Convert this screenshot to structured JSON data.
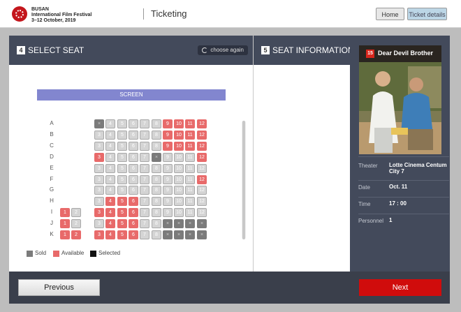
{
  "header": {
    "brand": [
      "BUSAN",
      "International Film Festival",
      "3–12 October, 2019"
    ],
    "page_title": "Ticketing",
    "home_label": "Home",
    "ticket_details_label": "Ticket details"
  },
  "select_seat": {
    "step_number": "4",
    "title": "SELECT SEAT",
    "choose_again_label": "choose again",
    "screen_label": "SCREEN",
    "rows": [
      {
        "label": "A",
        "left": [],
        "right": [
          {
            "n": "",
            "s": "sold"
          },
          {
            "n": "4",
            "s": "gray"
          },
          {
            "n": "5",
            "s": "gray"
          },
          {
            "n": "6",
            "s": "gray"
          },
          {
            "n": "7",
            "s": "gray"
          },
          {
            "n": "8",
            "s": "gray"
          },
          {
            "n": "9",
            "s": "avail"
          },
          {
            "n": "10",
            "s": "avail"
          },
          {
            "n": "11",
            "s": "avail"
          },
          {
            "n": "12",
            "s": "avail"
          }
        ]
      },
      {
        "label": "B",
        "left": [],
        "right": [
          {
            "n": "3",
            "s": "gray"
          },
          {
            "n": "4",
            "s": "gray"
          },
          {
            "n": "5",
            "s": "gray"
          },
          {
            "n": "6",
            "s": "gray"
          },
          {
            "n": "7",
            "s": "gray"
          },
          {
            "n": "8",
            "s": "gray"
          },
          {
            "n": "9",
            "s": "avail"
          },
          {
            "n": "10",
            "s": "avail"
          },
          {
            "n": "11",
            "s": "avail"
          },
          {
            "n": "12",
            "s": "avail"
          }
        ]
      },
      {
        "label": "C",
        "left": [],
        "right": [
          {
            "n": "3",
            "s": "gray"
          },
          {
            "n": "4",
            "s": "gray"
          },
          {
            "n": "5",
            "s": "gray"
          },
          {
            "n": "6",
            "s": "gray"
          },
          {
            "n": "7",
            "s": "gray"
          },
          {
            "n": "8",
            "s": "gray"
          },
          {
            "n": "9",
            "s": "avail"
          },
          {
            "n": "10",
            "s": "avail"
          },
          {
            "n": "11",
            "s": "avail"
          },
          {
            "n": "12",
            "s": "avail"
          }
        ]
      },
      {
        "label": "D",
        "left": [],
        "right": [
          {
            "n": "3",
            "s": "avail"
          },
          {
            "n": "4",
            "s": "gray"
          },
          {
            "n": "5",
            "s": "gray"
          },
          {
            "n": "6",
            "s": "gray"
          },
          {
            "n": "7",
            "s": "gray"
          },
          {
            "n": "",
            "s": "sold"
          },
          {
            "n": "9",
            "s": "gray"
          },
          {
            "n": "10",
            "s": "gray"
          },
          {
            "n": "11",
            "s": "gray"
          },
          {
            "n": "12",
            "s": "avail"
          }
        ]
      },
      {
        "label": "E",
        "left": [],
        "right": [
          {
            "n": "3",
            "s": "gray"
          },
          {
            "n": "4",
            "s": "gray"
          },
          {
            "n": "5",
            "s": "gray"
          },
          {
            "n": "6",
            "s": "gray"
          },
          {
            "n": "7",
            "s": "gray"
          },
          {
            "n": "8",
            "s": "gray"
          },
          {
            "n": "9",
            "s": "gray"
          },
          {
            "n": "10",
            "s": "gray"
          },
          {
            "n": "11",
            "s": "gray"
          },
          {
            "n": "12",
            "s": "gray"
          }
        ]
      },
      {
        "label": "F",
        "left": [],
        "right": [
          {
            "n": "3",
            "s": "gray"
          },
          {
            "n": "4",
            "s": "gray"
          },
          {
            "n": "5",
            "s": "gray"
          },
          {
            "n": "6",
            "s": "gray"
          },
          {
            "n": "7",
            "s": "gray"
          },
          {
            "n": "8",
            "s": "gray"
          },
          {
            "n": "9",
            "s": "gray"
          },
          {
            "n": "10",
            "s": "gray"
          },
          {
            "n": "11",
            "s": "gray"
          },
          {
            "n": "12",
            "s": "avail"
          }
        ]
      },
      {
        "label": "G",
        "left": [],
        "right": [
          {
            "n": "3",
            "s": "gray"
          },
          {
            "n": "4",
            "s": "gray"
          },
          {
            "n": "5",
            "s": "gray"
          },
          {
            "n": "6",
            "s": "gray"
          },
          {
            "n": "7",
            "s": "gray"
          },
          {
            "n": "8",
            "s": "gray"
          },
          {
            "n": "9",
            "s": "gray"
          },
          {
            "n": "10",
            "s": "gray"
          },
          {
            "n": "11",
            "s": "gray"
          },
          {
            "n": "12",
            "s": "gray"
          }
        ]
      },
      {
        "label": "H",
        "left": [],
        "right": [
          {
            "n": "3",
            "s": "gray"
          },
          {
            "n": "4",
            "s": "avail"
          },
          {
            "n": "5",
            "s": "avail"
          },
          {
            "n": "6",
            "s": "avail"
          },
          {
            "n": "7",
            "s": "gray"
          },
          {
            "n": "8",
            "s": "gray"
          },
          {
            "n": "9",
            "s": "gray"
          },
          {
            "n": "10",
            "s": "gray"
          },
          {
            "n": "11",
            "s": "gray"
          },
          {
            "n": "12",
            "s": "gray"
          }
        ]
      },
      {
        "label": "I",
        "left": [
          {
            "n": "1",
            "s": "avail"
          },
          {
            "n": "2",
            "s": "gray"
          }
        ],
        "right": [
          {
            "n": "3",
            "s": "avail"
          },
          {
            "n": "4",
            "s": "avail"
          },
          {
            "n": "5",
            "s": "avail"
          },
          {
            "n": "6",
            "s": "avail"
          },
          {
            "n": "7",
            "s": "gray"
          },
          {
            "n": "8",
            "s": "gray"
          },
          {
            "n": "9",
            "s": "gray"
          },
          {
            "n": "10",
            "s": "gray"
          },
          {
            "n": "11",
            "s": "gray"
          },
          {
            "n": "12",
            "s": "gray"
          }
        ]
      },
      {
        "label": "J",
        "left": [
          {
            "n": "1",
            "s": "avail"
          },
          {
            "n": "2",
            "s": "gray"
          }
        ],
        "right": [
          {
            "n": "3",
            "s": "gray"
          },
          {
            "n": "4",
            "s": "avail"
          },
          {
            "n": "5",
            "s": "avail"
          },
          {
            "n": "6",
            "s": "avail"
          },
          {
            "n": "7",
            "s": "gray"
          },
          {
            "n": "8",
            "s": "gray"
          },
          {
            "n": "",
            "s": "sold"
          },
          {
            "n": "",
            "s": "sold"
          },
          {
            "n": "",
            "s": "sold"
          },
          {
            "n": "",
            "s": "sold"
          }
        ]
      },
      {
        "label": "K",
        "left": [
          {
            "n": "1",
            "s": "avail"
          },
          {
            "n": "2",
            "s": "avail"
          }
        ],
        "right": [
          {
            "n": "3",
            "s": "avail"
          },
          {
            "n": "4",
            "s": "avail"
          },
          {
            "n": "5",
            "s": "avail"
          },
          {
            "n": "6",
            "s": "avail"
          },
          {
            "n": "7",
            "s": "gray"
          },
          {
            "n": "8",
            "s": "gray"
          },
          {
            "n": "",
            "s": "sold"
          },
          {
            "n": "",
            "s": "sold"
          },
          {
            "n": "",
            "s": "sold"
          },
          {
            "n": "",
            "s": "sold"
          }
        ]
      }
    ],
    "legend": [
      {
        "label": "Sold",
        "color": "#7b7b7b"
      },
      {
        "label": "Available",
        "color": "#e86a6a"
      },
      {
        "label": "Selected",
        "color": "#111111"
      }
    ]
  },
  "seat_information": {
    "step_number": "5",
    "title": "SEAT INFORMATION"
  },
  "movie": {
    "age_rating": "15",
    "title": "Dear Devil Brother",
    "details": [
      {
        "label": "Theater",
        "value": "Lotte Cinema Centum City 7"
      },
      {
        "label": "Date",
        "value": "Oct. 11"
      },
      {
        "label": "Time",
        "value": "17 : 00"
      },
      {
        "label": "Personnel",
        "value": "1"
      }
    ]
  },
  "footer": {
    "previous_label": "Previous",
    "next_label": "Next"
  },
  "colors": {
    "panel_header": "#434a5b",
    "screen": "#8286cf",
    "available": "#e86a6a",
    "next_button": "#d00c0c"
  }
}
